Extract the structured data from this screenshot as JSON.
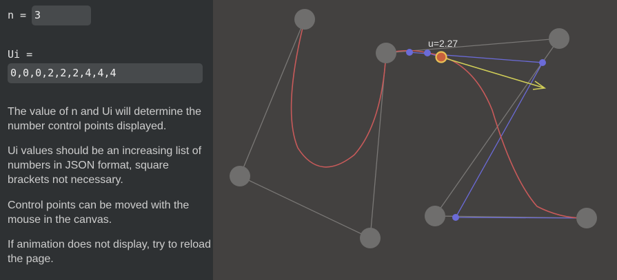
{
  "controls": {
    "n_label": "n =",
    "n_value": "3",
    "ui_label": "Ui =",
    "ui_value": "0,0,0,2,2,2,4,4,4"
  },
  "help": {
    "p1": "The value of n and Ui will determine the number control points displayed.",
    "p2": "Ui values should be an increasing list of numbers in JSON format, square brackets not necessary.",
    "p3": "Control points can be moved with the mouse in the canvas.",
    "p4": "If animation does not display, try to reload the page."
  },
  "canvas": {
    "u_label": "u=2.27"
  },
  "colors": {
    "sidebar_bg": "#2e3133",
    "canvas_bg": "#434140",
    "control_point": "#6f6e6d",
    "curve": "#c85a5a",
    "construction": "#6b6bd8",
    "tangent": "#d2cf58",
    "current_point": "#e9c256"
  }
}
